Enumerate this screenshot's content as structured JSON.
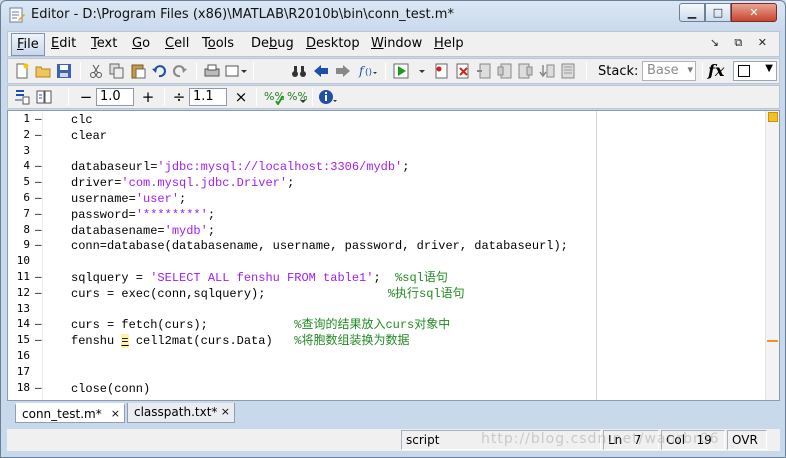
{
  "window": {
    "title": "Editor - D:\\Program Files (x86)\\MATLAB\\R2010b\\bin\\conn_test.m*",
    "min_glyph": "▁",
    "max_glyph": "□",
    "close_glyph": "✕"
  },
  "menubar": {
    "items": [
      {
        "label": "File",
        "u": "F",
        "rest": "ile"
      },
      {
        "label": "Edit",
        "u": "E",
        "rest": "dit"
      },
      {
        "label": "Text",
        "u": "T",
        "rest": "ext"
      },
      {
        "label": "Go",
        "u": "G",
        "rest": "o"
      },
      {
        "label": "Cell",
        "u": "C",
        "rest": "ell"
      },
      {
        "label": "Tools",
        "pre": "T",
        "u": "o",
        "rest": "ols"
      },
      {
        "label": "Debug",
        "pre": "De",
        "u": "b",
        "rest": "ug"
      },
      {
        "label": "Desktop",
        "u": "D",
        "rest": "esktop"
      },
      {
        "label": "Window",
        "u": "W",
        "rest": "indow"
      },
      {
        "label": "Help",
        "u": "H",
        "rest": "elp"
      }
    ],
    "right_controls": "↘ ⧉ ✕"
  },
  "toolbar": {
    "stack_label": "Stack:",
    "stack_value": "Base",
    "fx_label": "fx"
  },
  "cell_toolbar": {
    "minus": "−",
    "increment_1": "1.0",
    "plus": "+",
    "divide": "÷",
    "increment_2": "1.1",
    "times": "×"
  },
  "code_lines": [
    {
      "n": "1",
      "dash": "–",
      "segs": [
        {
          "t": "clc",
          "c": ""
        }
      ]
    },
    {
      "n": "2",
      "dash": "–",
      "segs": [
        {
          "t": "clear",
          "c": ""
        }
      ]
    },
    {
      "n": "3",
      "dash": "",
      "segs": []
    },
    {
      "n": "4",
      "dash": "–",
      "segs": [
        {
          "t": "databaseurl=",
          "c": ""
        },
        {
          "t": "'jdbc:mysql://localhost:3306/mydb'",
          "c": "str"
        },
        {
          "t": ";",
          "c": ""
        }
      ]
    },
    {
      "n": "5",
      "dash": "–",
      "segs": [
        {
          "t": "driver=",
          "c": ""
        },
        {
          "t": "'com.mysql.jdbc.Driver'",
          "c": "str"
        },
        {
          "t": ";",
          "c": ""
        }
      ]
    },
    {
      "n": "6",
      "dash": "–",
      "segs": [
        {
          "t": "username=",
          "c": ""
        },
        {
          "t": "'user'",
          "c": "str"
        },
        {
          "t": ";",
          "c": ""
        }
      ]
    },
    {
      "n": "7",
      "dash": "–",
      "segs": [
        {
          "t": "password=",
          "c": ""
        },
        {
          "t": "'********'",
          "c": "str"
        },
        {
          "t": ";",
          "c": ""
        }
      ]
    },
    {
      "n": "8",
      "dash": "–",
      "segs": [
        {
          "t": "databasename=",
          "c": ""
        },
        {
          "t": "'mydb'",
          "c": "str"
        },
        {
          "t": ";",
          "c": ""
        }
      ]
    },
    {
      "n": "9",
      "dash": "–",
      "segs": [
        {
          "t": "conn=database(databasename, username, password, driver, databaseurl);",
          "c": ""
        }
      ]
    },
    {
      "n": "10",
      "dash": "",
      "segs": []
    },
    {
      "n": "11",
      "dash": "–",
      "segs": [
        {
          "t": "sqlquery = ",
          "c": ""
        },
        {
          "t": "'SELECT ALL fenshu FROM table1'",
          "c": "str"
        },
        {
          "t": ";  ",
          "c": ""
        },
        {
          "t": "%sql语句",
          "c": "cmt"
        }
      ]
    },
    {
      "n": "12",
      "dash": "–",
      "segs": [
        {
          "t": "curs = exec(conn,sqlquery);                 ",
          "c": ""
        },
        {
          "t": "%执行sql语句",
          "c": "cmt"
        }
      ]
    },
    {
      "n": "13",
      "dash": "",
      "segs": []
    },
    {
      "n": "14",
      "dash": "–",
      "segs": [
        {
          "t": "curs = fetch(curs);            ",
          "c": ""
        },
        {
          "t": "%查询的结果放入curs对象中",
          "c": "cmt"
        }
      ]
    },
    {
      "n": "15",
      "dash": "–",
      "segs": [
        {
          "t": "fenshu ",
          "c": ""
        },
        {
          "t": "=",
          "c": "u"
        },
        {
          "t": " cell2mat(curs.Data)   ",
          "c": ""
        },
        {
          "t": "%将胞数组装换为数据",
          "c": "cmt"
        }
      ]
    },
    {
      "n": "16",
      "dash": "",
      "segs": []
    },
    {
      "n": "17",
      "dash": "",
      "segs": []
    },
    {
      "n": "18",
      "dash": "–",
      "segs": [
        {
          "t": "close(conn)",
          "c": ""
        }
      ]
    }
  ],
  "tabs": [
    {
      "label": "conn_test.m*",
      "close": "×"
    },
    {
      "label": "classpath.txt*",
      "close": "×"
    }
  ],
  "status": {
    "mode": "script",
    "ln_label": "Ln",
    "ln_value": "7",
    "col_label": "Col",
    "col_value": "19",
    "ovr": "OVR"
  },
  "watermark": "http://blog.csdn.net/wanrbr06"
}
